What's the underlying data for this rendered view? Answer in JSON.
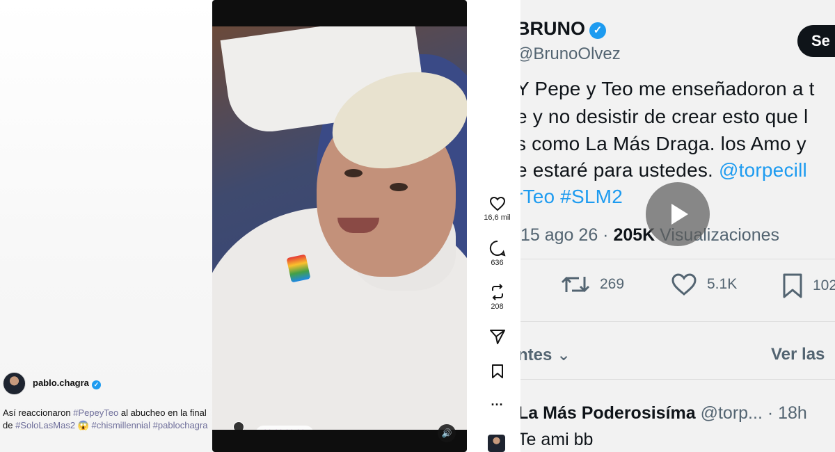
{
  "post": {
    "author": "pablo.chagra",
    "caption": {
      "t1": "Así reaccionaron ",
      "tag1": "#PepeyTeo",
      "t2": " al abucheo en la final de ",
      "tag2": "#SoloLasMas2",
      "emoji": " 😱 ",
      "tag3": "#chismillennial",
      "sp": " ",
      "tag4": "#pablochagra"
    }
  },
  "video": {
    "reactions_hearts": "💜💜💜💜"
  },
  "actions": {
    "likes": "16,6 mil",
    "comments": "636",
    "reposts": "208"
  },
  "tweet": {
    "name": "BRUNO",
    "handle": "@BrunoOlvez",
    "follow_label": "Se",
    "line1": "Y Pepe y Teo me enseñadoron a t",
    "line2": "e y no desistir de crear esto que l",
    "line3": "s como La Más Draga. los Amo y",
    "line4_text": "e estaré para ustedes. ",
    "line4_link": "@torpecill",
    "line5_link": "rTeo #SLM2",
    "date": "15 ago 26 · ",
    "views_count": "205K",
    "views_label": " Visualizaciones",
    "retweets": "269",
    "likes": "5.1K",
    "bookmarks": "102",
    "sort_label": "ntes",
    "ver_las": "Ver las",
    "reply_name": "La Más Poderosisíma",
    "reply_meta": " @torp... · 18h",
    "reply_text": "Te ami bb"
  }
}
